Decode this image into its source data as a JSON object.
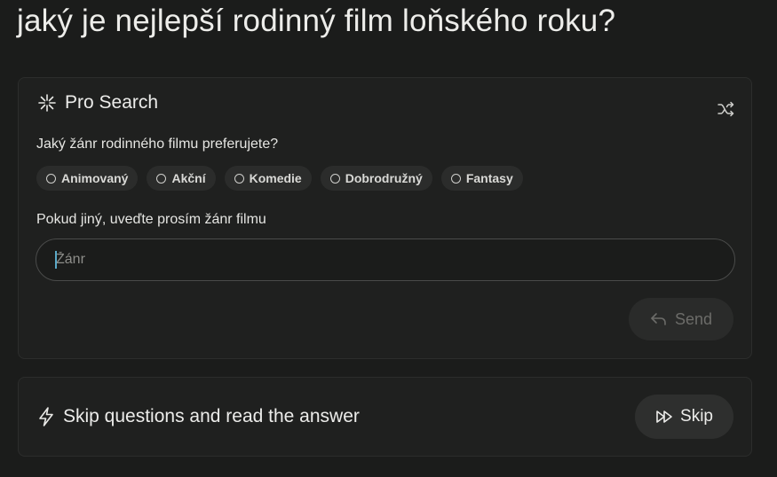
{
  "question": "jaký je nejlepší rodinný film loňského roku?",
  "pro_search": {
    "title": "Pro Search",
    "icon": "sparkle-icon",
    "shuffle_icon": "shuffle-icon",
    "genre_question": "Jaký žánr rodinného filmu preferujete?",
    "options": [
      "Animovaný",
      "Akční",
      "Komedie",
      "Dobrodružný",
      "Fantasy"
    ],
    "other_label": "Pokud jiný, uveďte prosím žánr filmu",
    "input_placeholder": "Žánr",
    "input_value": "",
    "send_label": "Send",
    "send_icon": "reply-arrow-icon"
  },
  "skip": {
    "text": "Skip questions and read the answer",
    "icon": "lightning-icon",
    "button_label": "Skip",
    "button_icon": "fast-forward-icon"
  },
  "colors": {
    "background": "#1b1c1b",
    "card": "#1f201f",
    "chip": "#2b2c2b",
    "caret": "#5aa9c7"
  }
}
